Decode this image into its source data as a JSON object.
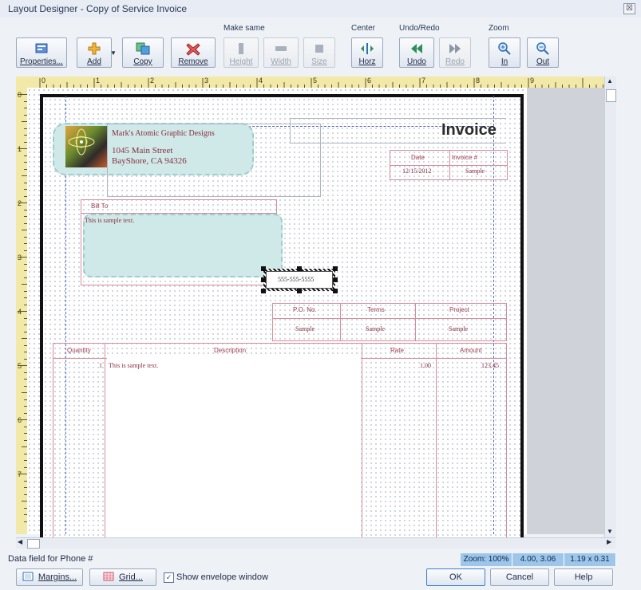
{
  "window": {
    "title": "Layout Designer - Copy of Service Invoice",
    "close_glyph": "☒"
  },
  "toolbar": {
    "main_buttons": [
      {
        "label": "Properties...",
        "icon": "properties-icon"
      },
      {
        "label": "Add",
        "icon": "add-icon"
      },
      {
        "label": "Copy",
        "icon": "copy-icon"
      },
      {
        "label": "Remove",
        "icon": "remove-icon"
      }
    ],
    "make_same": {
      "label": "Make same",
      "buttons": [
        "Height",
        "Width",
        "Size"
      ]
    },
    "center": {
      "label": "Center",
      "buttons": [
        "Horz"
      ]
    },
    "undo_redo": {
      "label": "Undo/Redo",
      "buttons": [
        "Undo",
        "Redo"
      ]
    },
    "zoom": {
      "label": "Zoom",
      "buttons": [
        "In",
        "Out"
      ]
    }
  },
  "ruler": {
    "numbers": [
      "0",
      "1",
      "2",
      "3",
      "4",
      "5",
      "6",
      "7",
      "8",
      "9"
    ],
    "vnumbers": [
      "0",
      "1",
      "2",
      "3",
      "4",
      "5",
      "6",
      "7"
    ]
  },
  "invoice": {
    "company_name": "Mark's Atomic Graphic Designs",
    "address_line1": "1045 Main Street",
    "address_line2": "BayShore, CA 94326",
    "logo_text": "Mark's Atomic Graphic Designs",
    "title": "Invoice",
    "date_header": "Date",
    "invoice_num_header": "Invoice #",
    "date_value": "12/15/2012",
    "invoice_num_value": "Sample",
    "bill_to_label": "Bill To",
    "bill_to_text": "This is sample text.",
    "phone_field": "555-555-5555",
    "po_header": "P.O. No.",
    "terms_header": "Terms",
    "project_header": "Project",
    "po_value": "Sample",
    "terms_value": "Sample",
    "project_value": "Sample",
    "columns": [
      "Quantity",
      "Description",
      "Rate",
      "Amount"
    ],
    "row": {
      "quantity": "1",
      "description": "This is sample text.",
      "rate": "1.00",
      "amount": "123.45"
    }
  },
  "status": {
    "field_info": "Data field for Phone #",
    "zoom": "Zoom: 100%",
    "position": "4.00, 3.06",
    "size": "1.19 x 0.31"
  },
  "bottom": {
    "margins_label": "Margins...",
    "grid_label": "Grid...",
    "envelope_label": "Show envelope window",
    "envelope_checked": true,
    "ok_label": "OK",
    "cancel_label": "Cancel",
    "help_label": "Help"
  },
  "colors": {
    "accent": "#9dc6ea",
    "field_border": "#d78d98",
    "ruler": "#f2e9a8",
    "shape_fill": "#cfe8e8"
  }
}
